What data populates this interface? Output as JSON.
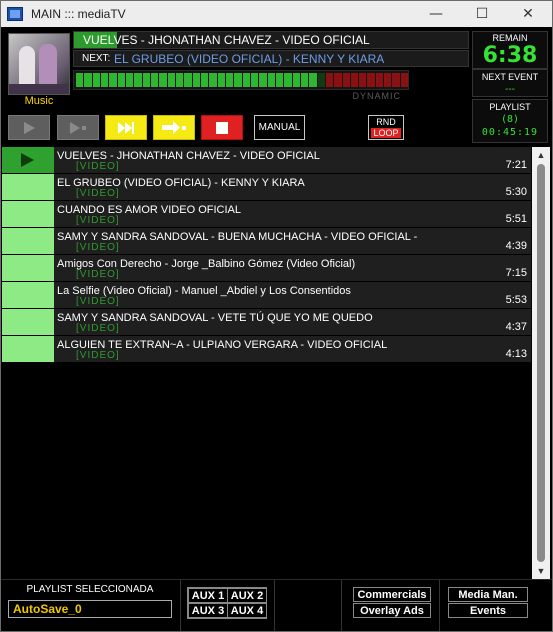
{
  "window": {
    "title": "MAIN ::: mediaTV",
    "controls": {
      "minimize": "—",
      "maximize": "☐",
      "close": "✕"
    }
  },
  "header": {
    "thumbnail_label": "Music",
    "now_playing": {
      "title": "VUELVES - JHONATHAN CHAVEZ - VIDEO OFICIAL",
      "progress_percent": 11
    },
    "next": {
      "label": "NEXT:",
      "title": "EL GRUBEO (VIDEO OFICIAL) - KENNY Y KIARA"
    },
    "meter": {
      "level_fraction": 0.72,
      "colors": {
        "green": "#2fb52f",
        "dark_green": "#1a5c1a",
        "red": "#8a1111"
      }
    },
    "dynamic_label": "DYNAMIC",
    "remain": {
      "label": "REMAIN",
      "value": "6:38"
    },
    "next_event": {
      "label": "NEXT EVENT",
      "value": "---"
    },
    "playlist": {
      "label": "PLAYLIST",
      "count": "(8)",
      "total": "00:45:19"
    }
  },
  "transport": {
    "play": "play",
    "play_next": "play-next",
    "skip": "skip",
    "stop_next": "stop-after",
    "stop": "stop",
    "manual_label": "MANUAL",
    "rnd_label": "RND",
    "loop_label": "LOOP"
  },
  "playlist_items": [
    {
      "title": "VUELVES - JHONATHAN CHAVEZ - VIDEO OFICIAL",
      "tag": "[VIDEO]",
      "duration": "7:21",
      "playing": true
    },
    {
      "title": "EL GRUBEO (VIDEO OFICIAL) - KENNY Y KIARA",
      "tag": "[VIDEO]",
      "duration": "5:30",
      "playing": false
    },
    {
      "title": "CUANDO ES AMOR VIDEO OFICIAL",
      "tag": "[VIDEO]",
      "duration": "5:51",
      "playing": false
    },
    {
      "title": "SAMY Y SANDRA SANDOVAL - BUENA MUCHACHA - VIDEO OFICIAL -",
      "tag": "[VIDEO]",
      "duration": "4:39",
      "playing": false
    },
    {
      "title": "Amigos Con Derecho - Jorge _Balbino Gómez (Video Oficial)",
      "tag": "[VIDEO]",
      "duration": "7:15",
      "playing": false
    },
    {
      "title": "La Selfie (Video Oficial) - Manuel _Abdiel y Los Consentidos",
      "tag": "[VIDEO]",
      "duration": "5:53",
      "playing": false
    },
    {
      "title": "SAMY Y SANDRA SANDOVAL - VETE TÚ QUE YO ME QUEDO",
      "tag": "[VIDEO]",
      "duration": "4:37",
      "playing": false
    },
    {
      "title": "ALGUIEN TE EXTRAN~A - ULPIANO VERGARA - VIDEO OFICIAL",
      "tag": "[VIDEO]",
      "duration": "4:13",
      "playing": false
    }
  ],
  "footer": {
    "playlist_selected_label": "PLAYLIST SELECCIONADA",
    "playlist_selected_value": "AutoSave_0",
    "aux": [
      "AUX 1",
      "AUX 2",
      "AUX 3",
      "AUX 4"
    ],
    "commercials": "Commercials",
    "overlay_ads": "Overlay Ads",
    "media_manager": "Media Man.",
    "events": "Events"
  }
}
